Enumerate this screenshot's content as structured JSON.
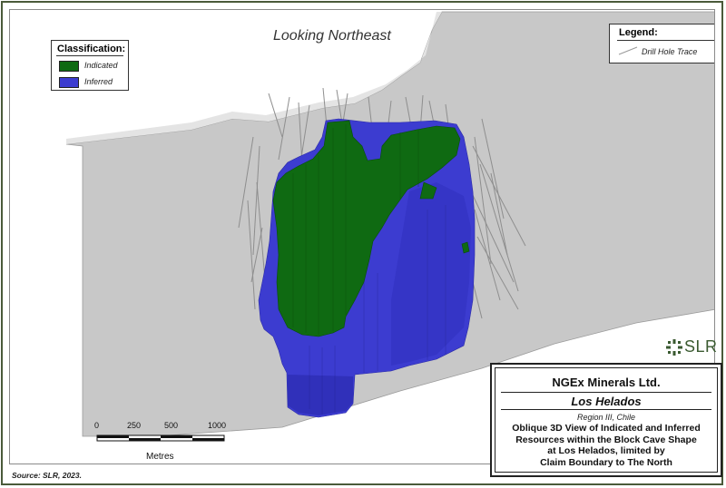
{
  "figure": {
    "view_title": "Looking Northeast",
    "source": "Source:  SLR, 2023."
  },
  "classification_legend": {
    "title": "Classification:",
    "items": [
      {
        "label": "Indicated",
        "color": "#0f6a12"
      },
      {
        "label": "Inferred",
        "color": "#3c3cd0"
      }
    ]
  },
  "trace_legend": {
    "title": "Legend:",
    "item_label": "Drill Hole Trace",
    "color": "#999999"
  },
  "scale_bar": {
    "ticks": [
      "0",
      "250",
      "500",
      "1000"
    ],
    "unit": "Metres"
  },
  "logo": {
    "text": "SLR",
    "color": "#3a5a30"
  },
  "title_block": {
    "company": "NGEx Minerals Ltd.",
    "project": "Los Helados",
    "region": "Region III, Chile",
    "description_lines": [
      "Oblique 3D View of Indicated and Inferred",
      "Resources within the Block Cave Shape",
      "at Los Helados, limited by",
      "Claim Boundary to The North"
    ]
  },
  "colors": {
    "indicated": "#0f6a12",
    "inferred": "#3c3cd0",
    "terrain": "#c8c8c8"
  }
}
